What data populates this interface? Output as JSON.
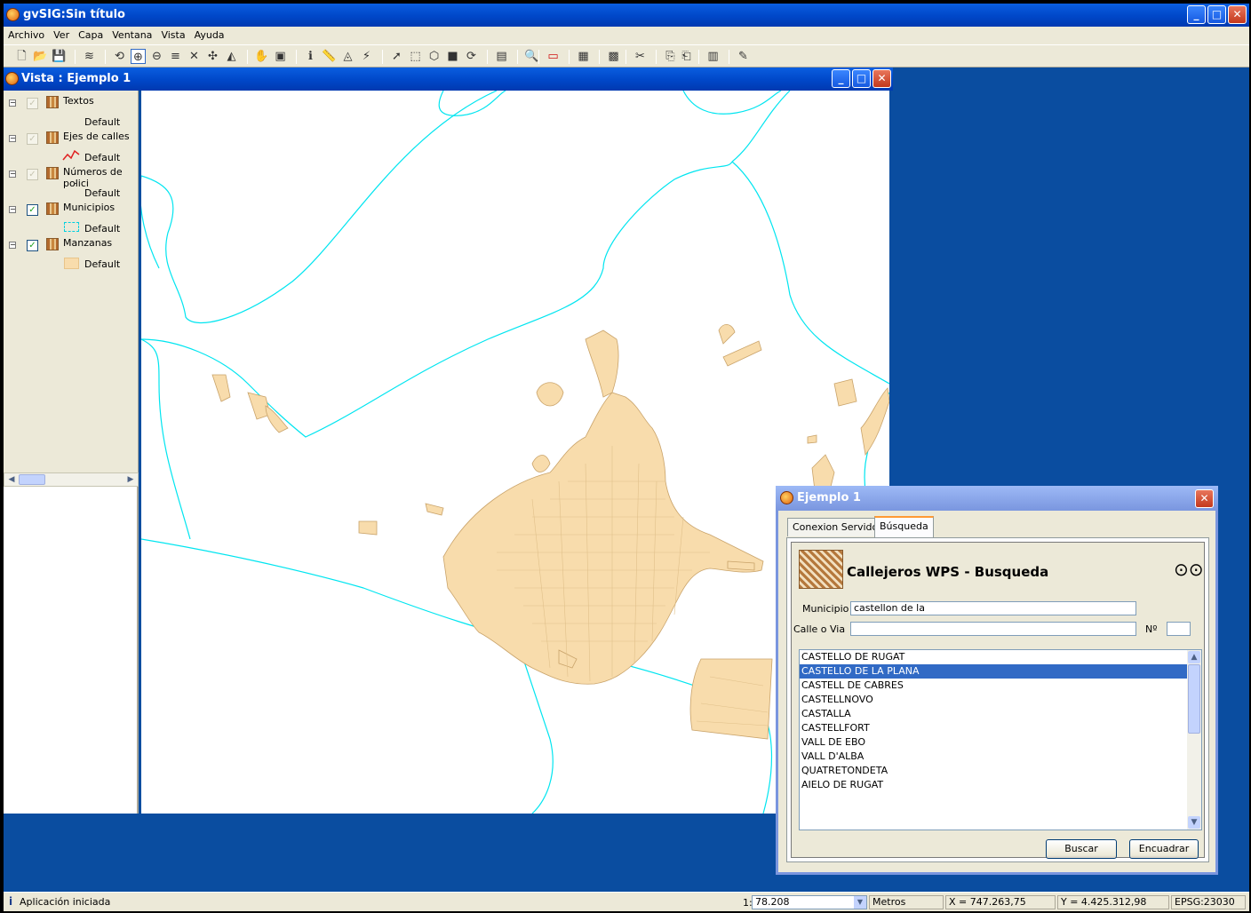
{
  "app": {
    "title": "gvSIG:Sin título"
  },
  "menu": [
    "Archivo",
    "Ver",
    "Capa",
    "Ventana",
    "Vista",
    "Ayuda"
  ],
  "window_controls": {
    "minimize": "_",
    "maximize": "□",
    "close": "✕"
  },
  "vista": {
    "title": "Vista : Ejemplo 1"
  },
  "toc": {
    "layers": [
      {
        "name": "Textos",
        "legend": "Default",
        "checked": false
      },
      {
        "name": "Ejes de calles",
        "legend": "Default",
        "checked": false
      },
      {
        "name": "Números de polici",
        "legend": "Default",
        "checked": false
      },
      {
        "name": "Municipios",
        "legend": "Default",
        "checked": true
      },
      {
        "name": "Manzanas",
        "legend": "Default",
        "checked": true
      }
    ]
  },
  "colors": {
    "map_lines": "#00e5f0",
    "blocks": "#f8dcac",
    "block_stroke": "#c9a36a",
    "selection": "#316ac5"
  },
  "dialog": {
    "title": "Ejemplo 1",
    "tabs": [
      "Conexion Servidor",
      "Búsqueda"
    ],
    "heading": "Callejeros WPS - Busqueda",
    "municipio_label": "Municipio",
    "municipio_value": "castellon de la",
    "calle_label": "Calle o Via",
    "calle_value": "",
    "numero_label": "Nº",
    "numero_value": "",
    "results": [
      "CASTELLO DE RUGAT",
      "CASTELLO DE LA PLANA",
      "CASTELL DE CABRES",
      "CASTELLNOVO",
      "CASTALLA",
      "CASTELLFORT",
      "VALL DE EBO",
      "VALL D'ALBA",
      "QUATRETONDETA",
      "AIELO DE RUGAT"
    ],
    "selected_index": 1,
    "buscar_label": "Buscar",
    "encuadrar_label": "Encuadrar"
  },
  "status": {
    "message": "Aplicación iniciada",
    "scale_prefix": "1:",
    "scale": "78.208",
    "units": "Metros",
    "x": "X = 747.263,75",
    "y": "Y = 4.425.312,98",
    "epsg": "EPSG:23030"
  }
}
